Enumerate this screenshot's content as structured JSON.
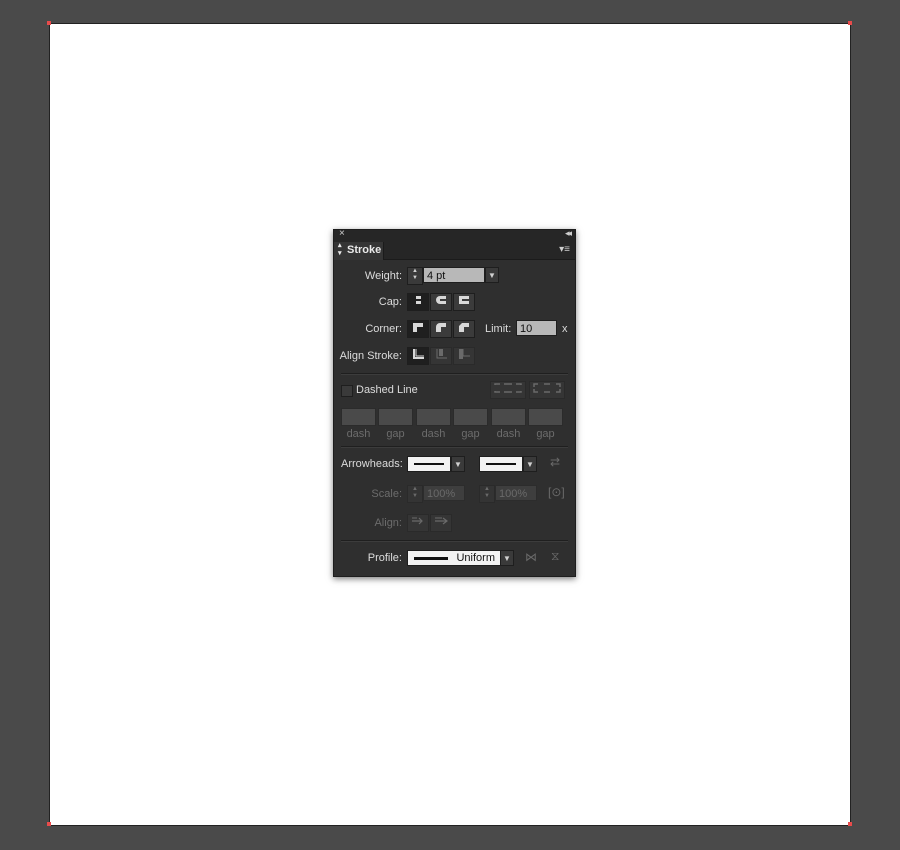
{
  "panel": {
    "close_glyph": "×",
    "collapse_glyph": "◂◂",
    "tab_label": "Stroke",
    "tab_arrows": "⌃⌄",
    "menu_glyph": "▾≡"
  },
  "weight": {
    "label": "Weight:",
    "value": "4 pt"
  },
  "cap": {
    "label": "Cap:",
    "options": [
      "butt-cap-icon",
      "round-cap-icon",
      "projecting-cap-icon"
    ],
    "selected": 0
  },
  "corner": {
    "label": "Corner:",
    "options": [
      "miter-join-icon",
      "round-join-icon",
      "bevel-join-icon"
    ],
    "selected": 0,
    "limit_label": "Limit:",
    "limit_value": "10",
    "limit_suffix": "x"
  },
  "align_stroke": {
    "label": "Align Stroke:",
    "options": [
      "align-center-icon",
      "align-inside-icon",
      "align-outside-icon"
    ],
    "selected": 0
  },
  "dashed": {
    "label": "Dashed Line",
    "checked": false,
    "fields": [
      {
        "label": "dash"
      },
      {
        "label": "gap"
      },
      {
        "label": "dash"
      },
      {
        "label": "gap"
      },
      {
        "label": "dash"
      },
      {
        "label": "gap"
      }
    ]
  },
  "arrowheads": {
    "label": "Arrowheads:",
    "scale_label": "Scale:",
    "scale_start": "100%",
    "scale_end": "100%",
    "align_label": "Align:"
  },
  "profile": {
    "label": "Profile:",
    "value": "Uniform"
  },
  "colors": {
    "panel_bg": "#2f2f2f",
    "artboard": "#ffffff",
    "canvas": "#4a4a4a",
    "artboard_corner": "#e84b4b"
  }
}
